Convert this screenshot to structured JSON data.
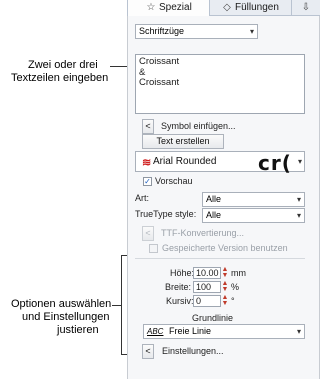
{
  "callouts": {
    "top_line1": "Zwei oder drei",
    "top_line2": "Textzeilen eingeben",
    "bottom_line1": "Optionen auswählen",
    "bottom_line2": "und Einstellungen",
    "bottom_line3": "justieren"
  },
  "tabs": {
    "spezial": "Spezial",
    "fuellungen": "Füllungen"
  },
  "type_select": "Schriftzüge",
  "text_lines": [
    "Croissant",
    "&",
    "Croissant"
  ],
  "symbol_button": "Symbol einfügen...",
  "create_text_button": "Text erstellen",
  "font": {
    "name": "Arial Rounded",
    "preview": "cr("
  },
  "preview_label": "Vorschau",
  "art_label": "Art:",
  "art_value": "Alle",
  "truetype_label": "TrueType style:",
  "truetype_value": "Alle",
  "ttf_button": "TTF-Konvertierung...",
  "saved_version_label": "Gespeicherte Version benutzen",
  "height_label": "Höhe:",
  "height_value": "10.00",
  "height_unit": "mm",
  "width_label": "Breite:",
  "width_value": "100",
  "width_unit": "%",
  "italic_label": "Kursiv:",
  "italic_value": "0",
  "italic_unit": "°",
  "baseline_label": "Grundlinie",
  "baseline_value": "Freie Linie",
  "baseline_icon_text": "ABC",
  "settings_button": "Einstellungen...",
  "colors": {
    "accent": "#1d5fbf",
    "spinner": "#c03b2b",
    "font_icon": "#d01f1f"
  }
}
